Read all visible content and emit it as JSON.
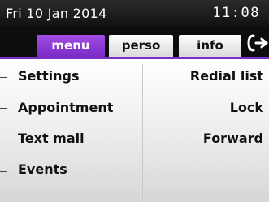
{
  "status": {
    "date": "Fri 10 Jan 2014",
    "time": "11:08"
  },
  "tabs": [
    {
      "label": "menu",
      "selected": true
    },
    {
      "label": "perso",
      "selected": false
    },
    {
      "label": "info",
      "selected": false
    }
  ],
  "icons": {
    "tab_forward": "call-forward-icon"
  },
  "menu": {
    "left": [
      "Settings",
      "Appointment",
      "Text mail",
      "Events"
    ],
    "right": [
      "Redial list",
      "Lock",
      "Forward"
    ]
  },
  "colors": {
    "accent": "#8a38d6",
    "status_bg": "#111111"
  }
}
